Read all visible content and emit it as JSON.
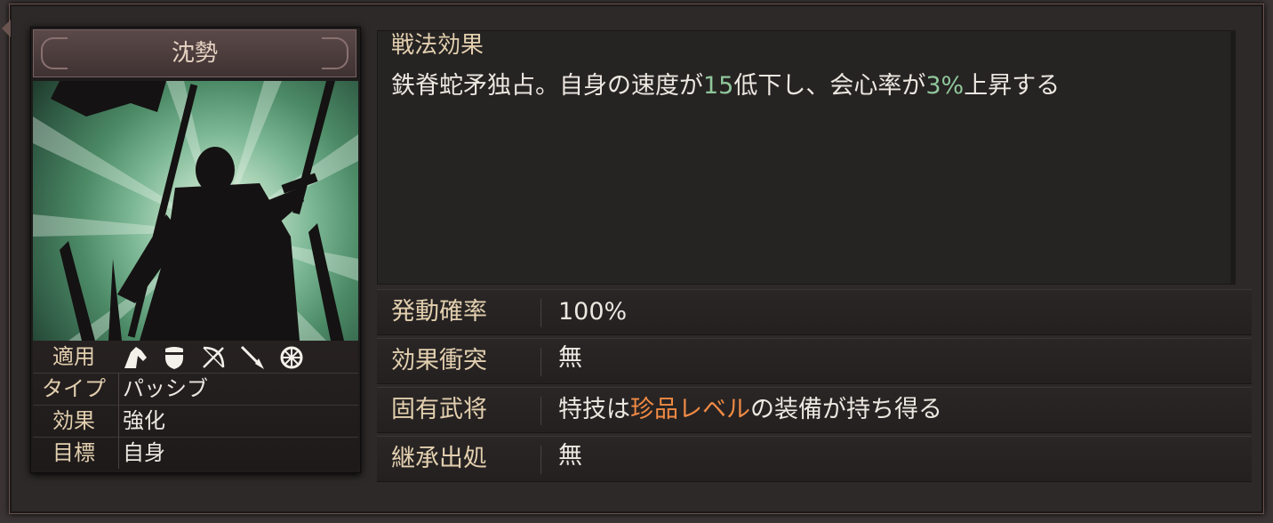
{
  "card": {
    "title": "沈勢",
    "rows": [
      {
        "label": "適用",
        "icons": [
          "cavalry-icon",
          "shield-icon",
          "bow-icon",
          "spear-icon",
          "wheel-icon"
        ]
      },
      {
        "label": "タイプ",
        "value": "パッシブ"
      },
      {
        "label": "効果",
        "value": "強化"
      },
      {
        "label": "目標",
        "value": "自身"
      }
    ]
  },
  "effect": {
    "title": "戦法効果",
    "text_parts": [
      "鉄脊蛇矛独占。自身の速度が",
      "15",
      "低下し、会心率が",
      "3%",
      "上昇する"
    ]
  },
  "stats": [
    {
      "label": "発動確率",
      "value": "100%"
    },
    {
      "label": "効果衝突",
      "value": "無"
    },
    {
      "label": "固有武将",
      "value_parts": [
        "特技は",
        "珍品レベル",
        "の装備が持ち得る"
      ]
    },
    {
      "label": "継承出処",
      "value": "無"
    }
  ],
  "colors": {
    "highlight_green": "#8fc79a",
    "highlight_orange": "#f08a44",
    "label_gold": "#e2cfae"
  }
}
